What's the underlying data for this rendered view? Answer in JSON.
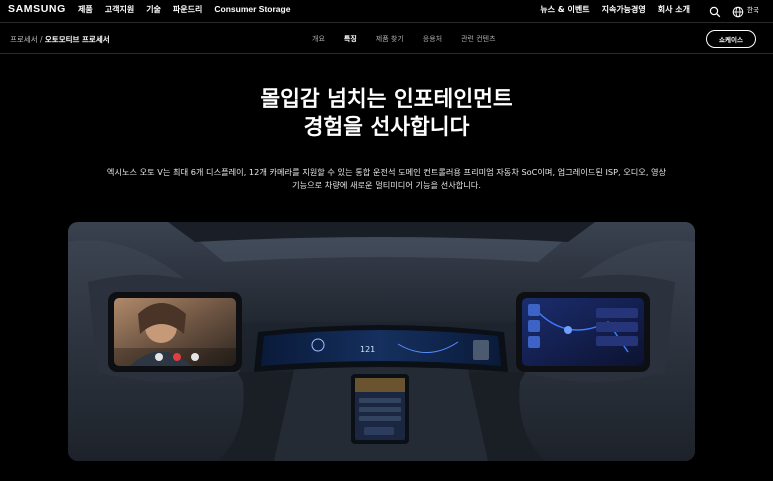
{
  "brand": "SAMSUNG",
  "nav": {
    "items": [
      "제품",
      "고객지원",
      "기술",
      "파운드리",
      "Consumer Storage"
    ],
    "right_items": [
      "뉴스 & 이벤트",
      "지속가능경영",
      "회사 소개"
    ],
    "lang": "한국"
  },
  "breadcrumb": {
    "parent": "프로세서 /",
    "current": "오토모티브 프로세서"
  },
  "tabs": [
    {
      "label": "개요",
      "active": false
    },
    {
      "label": "특징",
      "active": true
    },
    {
      "label": "제품 찾기",
      "active": false
    },
    {
      "label": "응용처",
      "active": false
    },
    {
      "label": "관련 컨텐츠",
      "active": false
    }
  ],
  "showcase_button": "쇼케이스",
  "headline": {
    "line1": "몰입감 넘치는 인포테인먼트",
    "line2": "경험을 선사합니다"
  },
  "description": {
    "line1": "엑시노스 오토 V는 최대 6개 디스플레이, 12개 카메라를 지원할 수 있는 통합 운전석 도메인 컨트롤러용 프리미엄 자동차 SoC이며, 업그레이드된 ISP, 오디오, 영상",
    "line2": "기능으로 차량에 새로운 멀티미디어 기능을 선사합니다."
  },
  "dash": {
    "speed": "121"
  },
  "icons": [
    "search-icon",
    "globe-icon"
  ],
  "colors": {
    "background": "#000000",
    "text": "#ffffff",
    "accent_blue": "#3d7bff"
  }
}
